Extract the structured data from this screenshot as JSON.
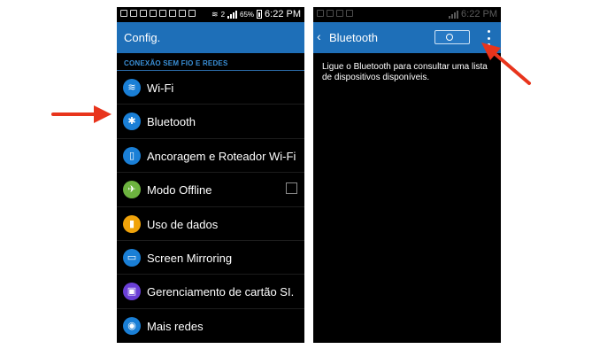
{
  "left_phone": {
    "status_bar": {
      "time": "6:22 PM",
      "battery_percent": "65%",
      "sim": "2"
    },
    "app_bar": {
      "title": "Config."
    },
    "section_header": "CONEXÃO SEM FIO E REDES",
    "items": [
      {
        "label": "Wi-Fi",
        "icon": "wifi-icon",
        "color": "#1a7fd6",
        "glyph": "≋"
      },
      {
        "label": "Bluetooth",
        "icon": "bluetooth-icon",
        "color": "#1a7fd6",
        "glyph": "✱"
      },
      {
        "label": "Ancoragem e Roteador Wi-Fi",
        "icon": "tethering-icon",
        "color": "#1a7fd6",
        "glyph": "▯"
      },
      {
        "label": "Modo Offline",
        "icon": "airplane-icon",
        "color": "#6db33f",
        "glyph": "✈",
        "checkbox": false
      },
      {
        "label": "Uso de dados",
        "icon": "data-usage-icon",
        "color": "#f0a30a",
        "glyph": "▮"
      },
      {
        "label": "Screen Mirroring",
        "icon": "screen-mirroring-icon",
        "color": "#1a7fd6",
        "glyph": "▭"
      },
      {
        "label": "Gerenciamento de cartão SI.",
        "icon": "sim-card-icon",
        "color": "#6a3fd6",
        "glyph": "▣"
      },
      {
        "label": "Mais redes",
        "icon": "more-networks-icon",
        "color": "#1a7fd6",
        "glyph": "◉"
      }
    ]
  },
  "right_phone": {
    "status_bar": {
      "time": "6:22 PM"
    },
    "app_bar": {
      "back_icon": "back-chevron-icon",
      "title": "Bluetooth",
      "toggle_state": "off",
      "menu_icon": "more-vert-icon"
    },
    "message": "Ligue o Bluetooth para consultar uma lista de dispositivos disponíveis."
  },
  "colors": {
    "accent": "#1e6fb8",
    "annotation_arrow": "#e8341c",
    "section_header": "#3a8fd6"
  }
}
